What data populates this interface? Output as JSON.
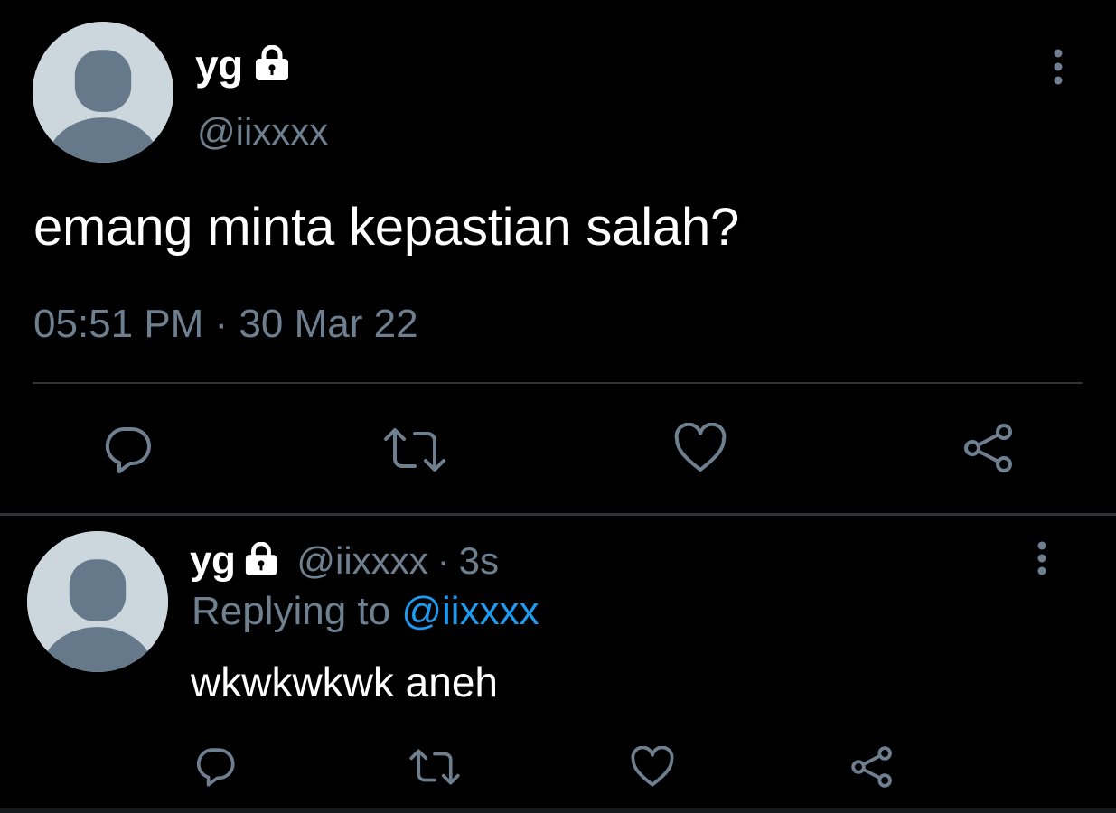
{
  "main_tweet": {
    "display_name": "yg",
    "handle": "@iixxxx",
    "text": "emang minta kepastian salah?",
    "timestamp": "05:51 PM · 30 Mar 22",
    "icons": {
      "lock": "lock-icon",
      "more": "more-vertical-icon",
      "reply": "reply-icon",
      "retweet": "retweet-icon",
      "like": "heart-icon",
      "share": "share-icon"
    }
  },
  "reply_tweet": {
    "display_name": "yg",
    "handle": "@iixxxx",
    "separator": "·",
    "time": "3s",
    "replying_prefix": "Replying to ",
    "replying_handle": "@iixxxx",
    "text": "wkwkwkwk aneh"
  },
  "colors": {
    "background": "#000000",
    "text_primary": "#ffffff",
    "text_secondary": "#6e7f8f",
    "link": "#1d9bf0",
    "divider": "#2f3336",
    "avatar_bg": "#ccd6dd",
    "avatar_figure": "#66798a",
    "icon": "#6e7f8f"
  }
}
